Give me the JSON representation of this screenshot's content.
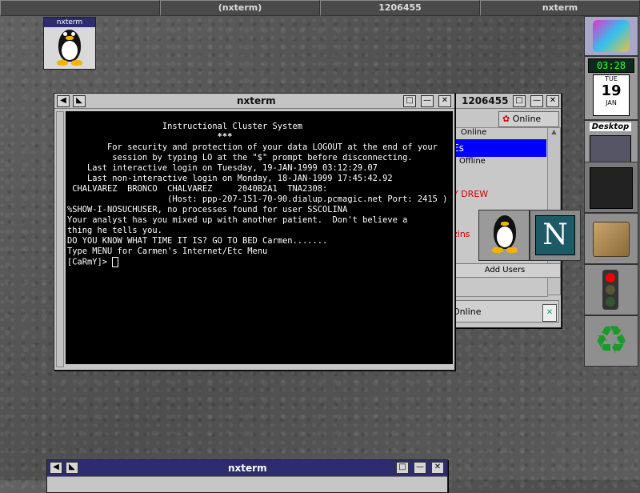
{
  "pager": {
    "desks": [
      "",
      "(nxterm)",
      "1206455",
      "nxterm"
    ]
  },
  "iconified_terminal": {
    "title": "nxterm"
  },
  "main_terminal": {
    "title": "nxterm",
    "lines": [
      "",
      "",
      "",
      "                   Instructional Cluster System",
      "",
      "                              ***",
      "",
      "        For security and protection of your data LOGOUT at the end of your",
      "         session by typing LO at the \"$\" prompt before disconnecting.",
      "",
      "",
      "    Last interactive login on Tuesday, 19-JAN-1999 03:12:29.07",
      "    Last non-interactive login on Monday, 18-JAN-1999 17:45:42.92",
      " CHALVAREZ  BRONCO  CHALVAREZ     2040B2A1  TNA2308:",
      "                    (Host: ppp-207-151-70-90.dialup.pcmagic.net Port: 2415 )",
      "%SHOW-I-NOSUCHUSER, no processes found for user SSCOLINA",
      "",
      "Your analyst has you mixed up with another patient.  Don't believe a",
      "thing he tells you.",
      "",
      "DO YOU KNOW WHAT TIME IT IS? GO TO BED Carmen.......",
      "Type MENU for Carmen's Internet/Etc Menu",
      "[CaRmY]> "
    ]
  },
  "icq_window": {
    "title": "1206455",
    "status": "Online",
    "groups": {
      "online": "Online",
      "offline": "Offline"
    },
    "contacts": [
      {
        "label": "Es",
        "color": "#ffffff",
        "selected": true
      },
      {
        "label": "Y DREW",
        "color": "#d00000",
        "selected": false
      },
      {
        "label": "zins",
        "color": "#d00000",
        "selected": false
      }
    ],
    "add_users_label": "Add Users",
    "status_bottom": "Online"
  },
  "bottom_terminal": {
    "title": "nxterm"
  },
  "dock": {
    "clock_time": "03:28",
    "calendar_day": "TUE",
    "calendar_date": "19",
    "calendar_month": "JAN",
    "desktop_label": "Desktop"
  },
  "colors": {
    "title_active": "#2c2c6e",
    "terminal_bg": "#000000",
    "selection": "#0000ff"
  }
}
